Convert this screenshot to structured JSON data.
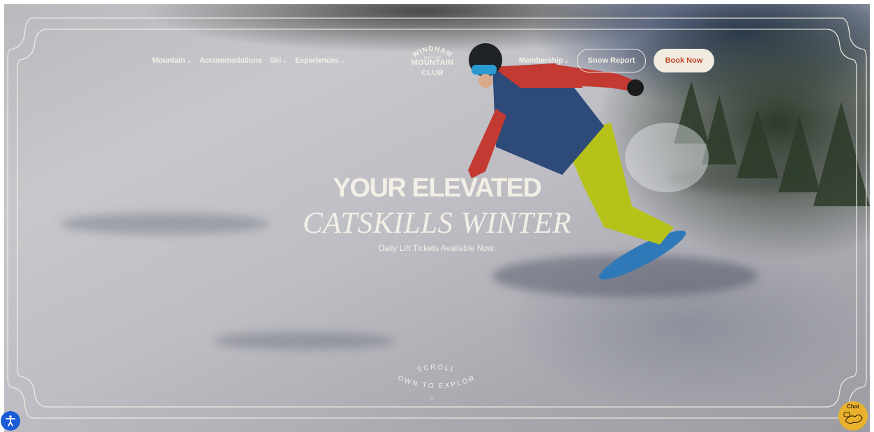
{
  "nav": {
    "left": [
      {
        "label": "Mountain",
        "has_dropdown": true
      },
      {
        "label": "Accommodations",
        "has_dropdown": false
      },
      {
        "label": "Ski",
        "has_dropdown": true
      },
      {
        "label": "Experiences",
        "has_dropdown": true
      }
    ],
    "membership": {
      "label": "Membership",
      "has_dropdown": true
    },
    "snow_report": "Snow Report",
    "book_now": "Book Now",
    "chevron": "⌄"
  },
  "logo": {
    "arc": "WINDHAM",
    "small": "NEW YORK",
    "line1": "MOUNTAIN",
    "line2": "CLUB"
  },
  "hero": {
    "headline": "YOUR ELEVATED",
    "subhead": "CATSKILLS WINTER",
    "tagline": "Daily Lift Tickets Available Now."
  },
  "scroll": {
    "top": "SCROLL",
    "bottom": "DOWN TO EXPLORE",
    "arrow": "⌄"
  },
  "widgets": {
    "accessibility_icon": "accessibility-icon",
    "chat_label": "Chat"
  },
  "colors": {
    "cream": "#f3efe6",
    "book_button_bg": "#f1ebe0",
    "book_button_text": "#c24a2c",
    "accessibility_blue": "#1a5bd6",
    "chat_yellow": "#e9b12c"
  }
}
